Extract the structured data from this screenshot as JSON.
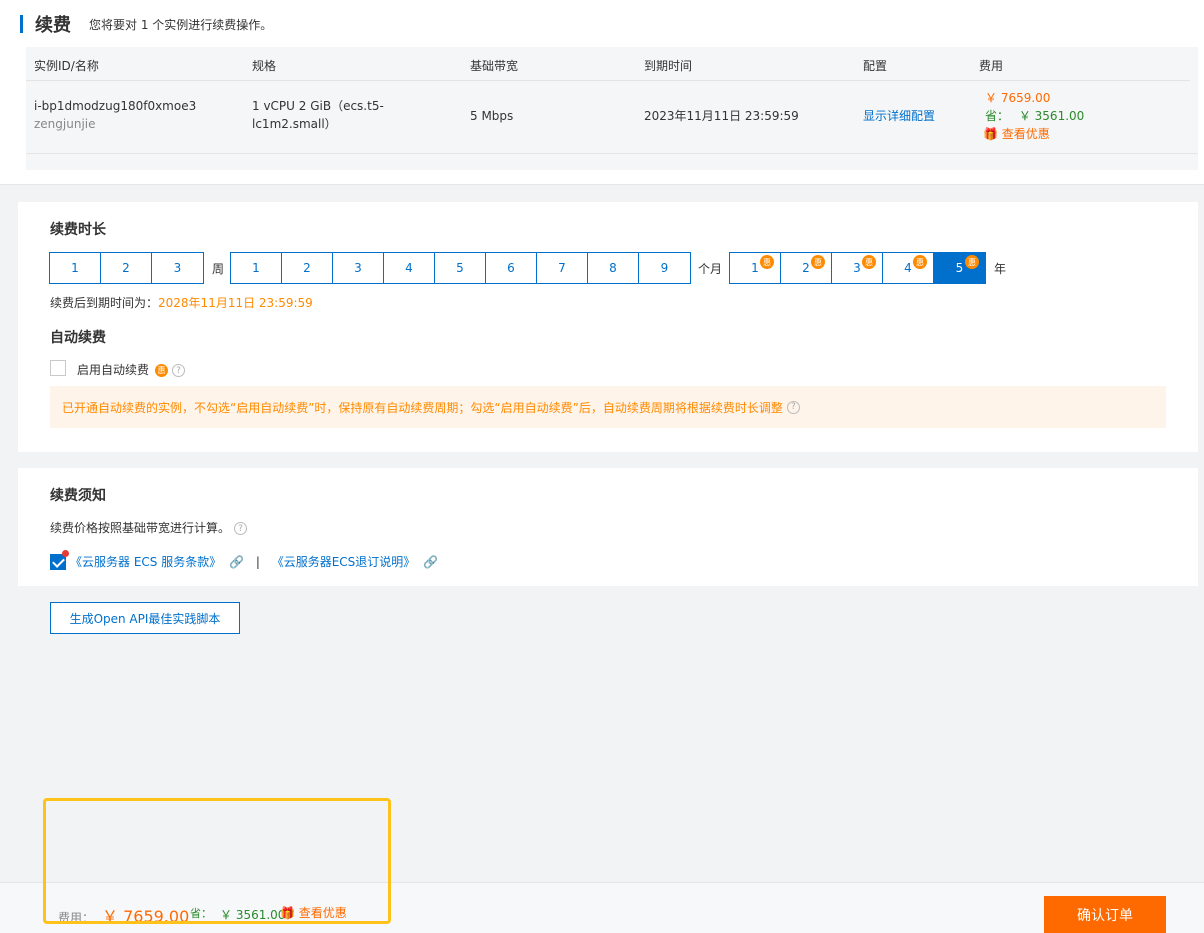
{
  "header": {
    "title": "续费",
    "subtitle": "您将要对 1 个实例进行续费操作。"
  },
  "table": {
    "columns": [
      "实例ID/名称",
      "规格",
      "基础带宽",
      "到期时间",
      "配置",
      "费用"
    ],
    "row": {
      "instance_id": "i-bp1dmodzug180f0xmoe3",
      "instance_name": "zengjunjie",
      "spec_line1": "1 vCPU 2 GiB（ecs.t5-",
      "spec_line2": "lc1m2.small）",
      "bandwidth": "5 Mbps",
      "expire": "2023年11月11日 23:59:59",
      "config_link": "显示详细配置",
      "price": "￥ 7659.00",
      "save_label": "省：",
      "save_amount": "￥ 3561.00",
      "offer_link": "查看优惠"
    }
  },
  "duration": {
    "title": "续费时长",
    "weeks": [
      "1",
      "2",
      "3"
    ],
    "week_unit": "周",
    "months": [
      "1",
      "2",
      "3",
      "4",
      "5",
      "6",
      "7",
      "8",
      "9"
    ],
    "month_unit": "个月",
    "years": [
      "1",
      "2",
      "3",
      "4",
      "5"
    ],
    "year_unit": "年",
    "discount_badge": "惠",
    "selected_year": "5",
    "expire_label": "续费后到期时间为：",
    "expire_value": "2028年11月11日 23:59:59"
  },
  "auto_renew": {
    "title": "自动续费",
    "checkbox_label": "启用自动续费",
    "checked": false,
    "notice": "已开通自动续费的实例，不勾选“启用自动续费”时，保持原有自动续费周期；勾选“启用自动续费”后，自动续费周期将根据续费时长调整"
  },
  "terms": {
    "title": "续费须知",
    "note": "续费价格按照基础带宽进行计算。",
    "agreement1": "《云服务器 ECS 服务条款》",
    "separator": "|",
    "agreement2": "《云服务器ECS退订说明》",
    "checked": true
  },
  "api_button": "生成Open API最佳实践脚本",
  "footer": {
    "fee_label": "费用：",
    "fee_value": "￥ 7659.00",
    "save_label": "省：",
    "save_value": "￥ 3561.00",
    "offer_link": "查看优惠",
    "confirm_button": "确认订单"
  },
  "colors": {
    "primary": "#0070cc",
    "orange": "#ff6a00",
    "highlight": "#ffc21a"
  }
}
